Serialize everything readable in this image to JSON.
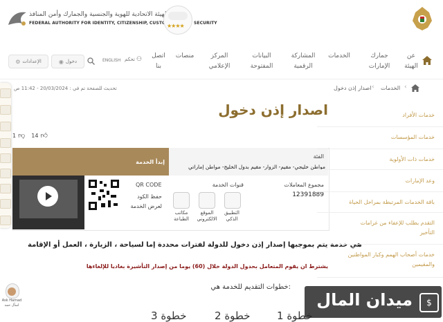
{
  "header": {
    "authority_ar": "الهيئة الاتحادية للهوية والجنسية والجمارك وأمن المنافذ",
    "authority_en": "FEDERAL AUTHORITY FOR IDENTITY, CITIZENSHIP, CUSTOMS & PORT SECURITY",
    "stars": "★★★★"
  },
  "nav": {
    "items": [
      "عن الهيئة",
      "جمارك الإمارات",
      "الخدمات",
      "المشاركة الرقمية",
      "البيانات المفتوحة",
      "المركز الإعلامي",
      "منصات",
      "اتصل بنا"
    ],
    "settings_label": "الإعدادات",
    "login_label": "دخول",
    "english_label": "ENGLISH",
    "accessibility_label": "تحكم"
  },
  "breadcrumb": {
    "items": [
      "الخدمات",
      "اصدار إذن دخول"
    ],
    "last_updated": "آخر تحديث للصفحة تم في : 20/03/2024 - 11:42 ص"
  },
  "page": {
    "title": "اصدار إذن دخول",
    "likes": "14",
    "dislikes": "1",
    "start_service": "إبدأ الخدمة",
    "category_label": "الفئة",
    "category_value": "مواطن خليجي- مقيم- الزوار- مقيم بدول الخليج- مواطن إماراتي",
    "transactions_label": "مجموع المعاملات",
    "transactions_value": "12391889",
    "channels_label": "قنوات الخدمة",
    "channels": [
      "التطبيق الذكي",
      "الموقع الالكتروني",
      "مكاتب الطباعة"
    ],
    "qr_label": "QR CODE",
    "qr_note": "حفظ الكود لعرض الخدمة",
    "description": "هي خدمة يتم بموجبها إصدار إذن دخول للدولة لفترات محددة إما لسياحة ، الزيارة ، العمل أو الإقامة",
    "condition": "يشترط ان يقوم المتعامل بحدول الدولة خلال (60) يوما من إصدار التأشيرة  بغاديا للإلغاءها",
    "steps_heading": "خطوات التقديم للخدمة هي:",
    "steps": [
      "خطوة 1",
      "خطوة 2",
      "خطوة 3"
    ]
  },
  "sidebar": {
    "items": [
      "خدمات الأفراد",
      "خدمات المؤسسات",
      "خدمات ذات الأولوية",
      "وعد الإمارات",
      "باقة الخدمات المرتبطة بمراحل الحياة",
      "التقدم بطلب للإعفاء من غرامات التأخير",
      "خدمات أصحاب الهمم وكبار المواطنين والمقيمين"
    ]
  },
  "watermark": {
    "text": "ميدان المال"
  },
  "assistant": {
    "name": "Ask Hamad",
    "sub": "اسأل حمد"
  },
  "colors": {
    "gold": "#8c6d2e",
    "brown_band": "#a8895a",
    "sidebar_text": "#c29a4a"
  }
}
